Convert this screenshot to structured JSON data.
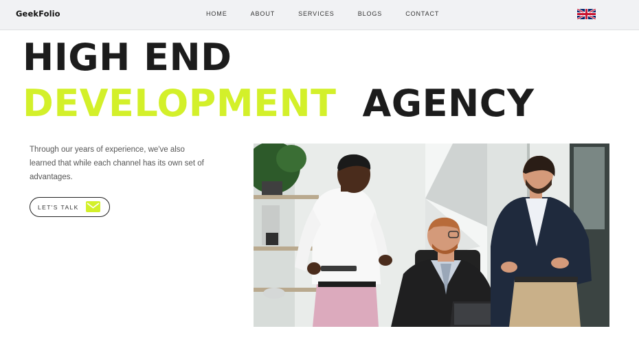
{
  "brand": {
    "logo_text": "GeekFolio"
  },
  "nav": {
    "items": [
      {
        "label": "HOME"
      },
      {
        "label": "ABOUT"
      },
      {
        "label": "SERVICES"
      },
      {
        "label": "BLOGS"
      },
      {
        "label": "CONTACT"
      }
    ],
    "language_icon": "uk-flag-icon"
  },
  "hero": {
    "line1": "HIGH END",
    "line2_accent": "DEVELOPMENT",
    "line2_dark": "AGENCY",
    "intro": "Through our years of experience, we've also learned that while each channel has its own set of advantages.",
    "cta_label": "LET'S TALK",
    "cta_icon": "mail-icon"
  },
  "colors": {
    "accent": "#d3f02a",
    "text_dark": "#1c1c1c",
    "navbar_bg": "#f1f2f4"
  }
}
